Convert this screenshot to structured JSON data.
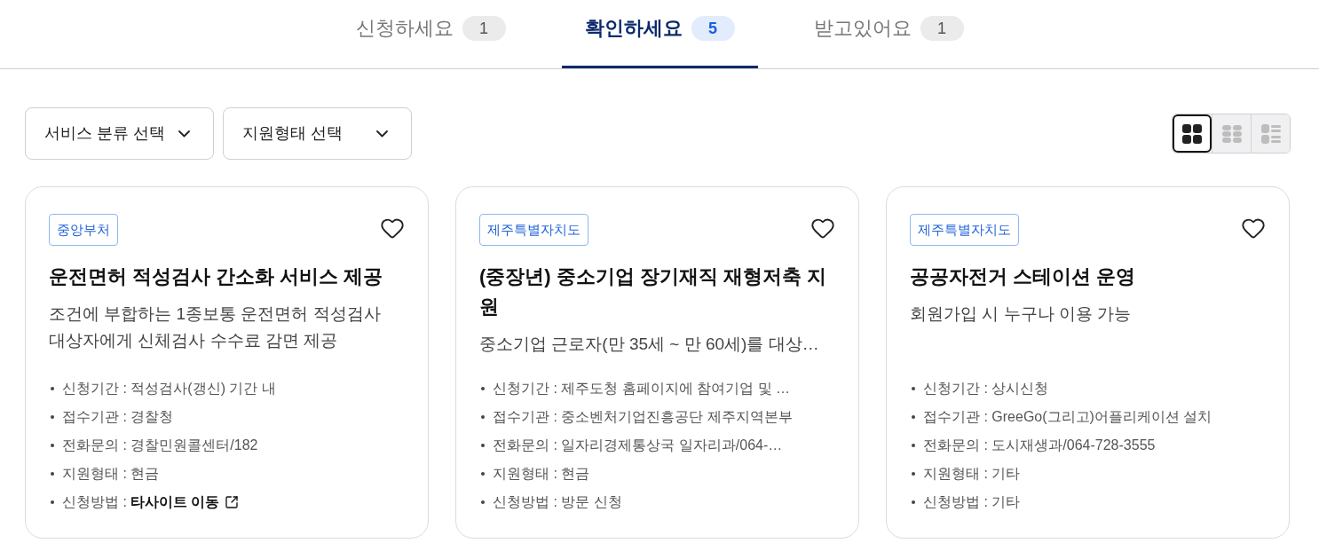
{
  "tabs": [
    {
      "label": "신청하세요",
      "count": "1",
      "selected": false
    },
    {
      "label": "확인하세요",
      "count": "5",
      "selected": true
    },
    {
      "label": "받고있어요",
      "count": "1",
      "selected": false
    }
  ],
  "filters": [
    {
      "label": "서비스 분류 선택"
    },
    {
      "label": "지원형태 선택"
    }
  ],
  "view_options": [
    {
      "kind": "grid",
      "selected": true
    },
    {
      "kind": "compact-grid",
      "selected": false
    },
    {
      "kind": "list",
      "selected": false
    }
  ],
  "cards": [
    {
      "tag": "중앙부처",
      "liked": false,
      "title": "운전면허 적성검사 간소화 서비스 제공",
      "description": "조건에 부합하는 1종보통 운전면허 적성검사 대상자에게 신체검사 수수료 감면 제공",
      "details": [
        {
          "kind": "text",
          "label": "신청기간 :",
          "value": "적성검사(갱신) 기간 내"
        },
        {
          "kind": "text",
          "label": "접수기관 :",
          "value": "경찰청"
        },
        {
          "kind": "text",
          "label": "전화문의 :",
          "value": "경찰민원콜센터/182"
        },
        {
          "kind": "text",
          "label": "지원형태 :",
          "value": "현금"
        },
        {
          "kind": "link",
          "label": "신청방법 :",
          "value": "타사이트 이동"
        }
      ]
    },
    {
      "tag": "제주특별자치도",
      "liked": false,
      "title": "(중장년) 중소기업 장기재직 재형저축 지원",
      "description": "중소기업 근로자(만 35세 ~ 만 60세)를 대상…",
      "details": [
        {
          "kind": "text",
          "label": "신청기간 :",
          "value": "제주도청 홈페이지에 참여기업 및 …"
        },
        {
          "kind": "text",
          "label": "접수기관 :",
          "value": "중소벤처기업진흥공단 제주지역본부"
        },
        {
          "kind": "text",
          "label": "전화문의 :",
          "value": "일자리경제통상국 일자리과/064-…"
        },
        {
          "kind": "text",
          "label": "지원형태 :",
          "value": "현금"
        },
        {
          "kind": "text",
          "label": "신청방법 :",
          "value": "방문 신청"
        }
      ]
    },
    {
      "tag": "제주특별자치도",
      "liked": false,
      "title": "공공자전거 스테이션 운영",
      "description": "회원가입 시 누구나 이용 가능",
      "details": [
        {
          "kind": "text",
          "label": "신청기간 :",
          "value": "상시신청"
        },
        {
          "kind": "text",
          "label": "접수기관 :",
          "value": "GreeGo(그리고)어플리케이션 설치"
        },
        {
          "kind": "text",
          "label": "전화문의 :",
          "value": "도시재생과/064-728-3555"
        },
        {
          "kind": "text",
          "label": "지원형태 :",
          "value": "기타"
        },
        {
          "kind": "text",
          "label": "신청방법 :",
          "value": "기타"
        }
      ]
    }
  ]
}
